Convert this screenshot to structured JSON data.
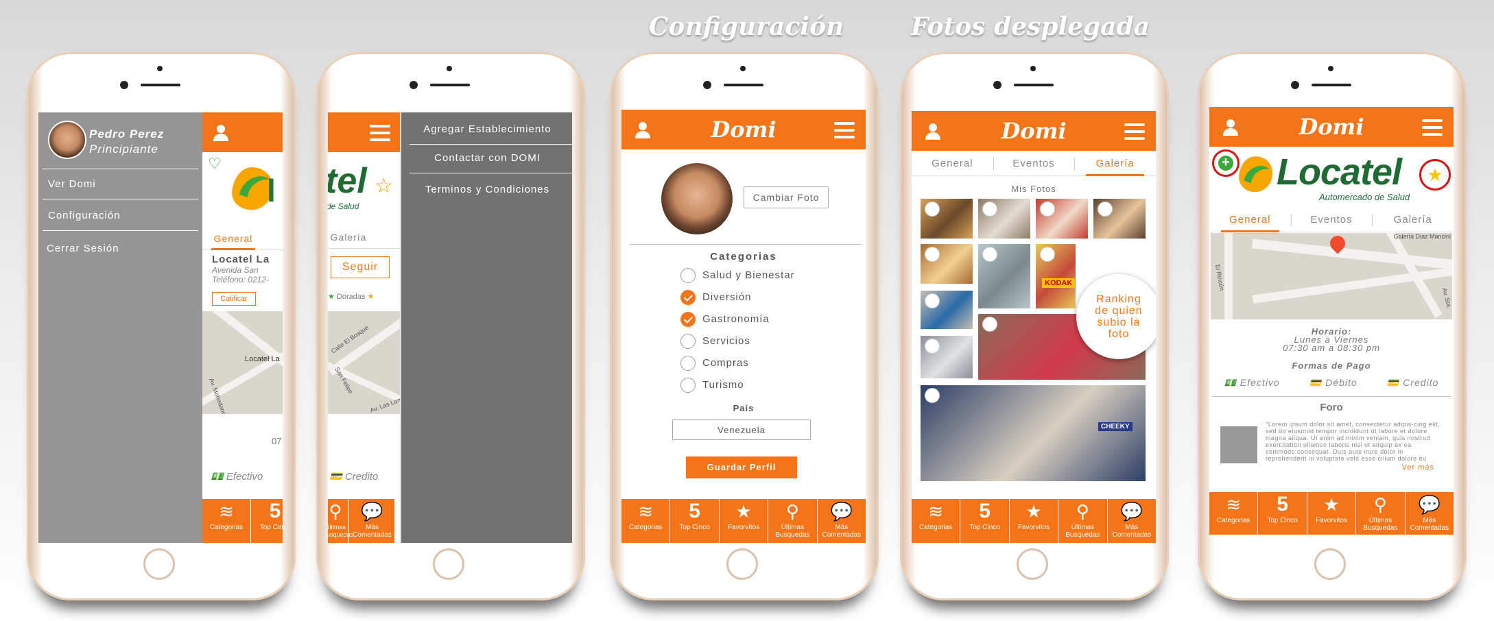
{
  "headings": {
    "config": "Configuración",
    "fotos": "Fotos desplegada"
  },
  "brand": {
    "app_name": "Domi",
    "accent": "#f57417",
    "gray_panel": "#959595",
    "dark_panel": "#727272"
  },
  "menu": {
    "user_name": "Pedro Perez",
    "user_level": "Principiante",
    "items": [
      "Ver Domi",
      "Configuración",
      "Cerrar Sesión"
    ]
  },
  "right_menu": {
    "items": [
      "Agregar Establecimiento",
      "Contactar con DOMI",
      "Terminos y Condiciones"
    ]
  },
  "establishment": {
    "name_partial": "Locatel La",
    "address_partial": "Avenida San",
    "phone_partial": "Teléfono: 0212-",
    "rate_button": "Calificar",
    "follow_button": "Seguir",
    "doradas": "Doradas",
    "map_label": "Locatel La",
    "pay_partial": "Efectivo",
    "credit": "Credito",
    "logo_name": "Locatel",
    "logo_tagline": "Automercado de Salud",
    "logo_partial": "tel",
    "logo_tagline_partial": "de Salud",
    "map_streets": [
      "Calle El Bosque",
      "San Felipe",
      "Av. Las Lamas",
      "Av. Mohedano",
      "El Rincón",
      "Av. Sta.",
      "Galería Diaz Mancini"
    ],
    "hours_partial": "07"
  },
  "tabs": {
    "general": "General",
    "eventos": "Eventos",
    "galeria": "Galería"
  },
  "config": {
    "change_photo": "Cambiar Foto",
    "categories_title": "Categorias",
    "categories": [
      {
        "label": "Salud y Bienestar",
        "checked": false
      },
      {
        "label": "Diversión",
        "checked": true
      },
      {
        "label": "Gastronomía",
        "checked": true
      },
      {
        "label": "Servicios",
        "checked": false
      },
      {
        "label": "Compras",
        "checked": false
      },
      {
        "label": "Turismo",
        "checked": false
      }
    ],
    "country_label": "Pais",
    "country_value": "Venezuela",
    "save": "Guardar Perfil"
  },
  "gallery": {
    "title": "Mis Fotos",
    "ranking_note": "Ranking de quien subio la foto",
    "signs": [
      "KODAK",
      "CHEEKY"
    ]
  },
  "detail": {
    "schedule_title": "Horario:",
    "schedule_days": "Lunes a Viernes",
    "schedule_time": "07:30 am a 08:30 pm",
    "payment_title": "Formas de Pago",
    "payments": [
      "Efectivo",
      "Débito",
      "Credito"
    ],
    "forum_title": "Foro",
    "forum_text": "\"Lorem ipsum dolor sit amet, consectetur adipis-cing elit, sed do eiusmod tempor incididunt ut labore et dolore magna aliqua. Ut enim ad minim veniam, quis nostrud exercitation ullamco laboris nisi ut aliquip ex ea commodo consequat. Duis aute irure dolor in reprehenderit in voluptate velit esse cillum dolore eu fugiat nulla paria-tur...",
    "more": "Ver más"
  },
  "bottom_nav": [
    {
      "label": "Categorias",
      "icon": "layers-icon"
    },
    {
      "label": "Top Cinco",
      "value": "5"
    },
    {
      "label": "Favorvitos",
      "icon": "star-icon"
    },
    {
      "label": "Últimas Busquedas",
      "icon": "search-icon"
    },
    {
      "label": "Más Comentadas",
      "icon": "chat-icon"
    }
  ]
}
